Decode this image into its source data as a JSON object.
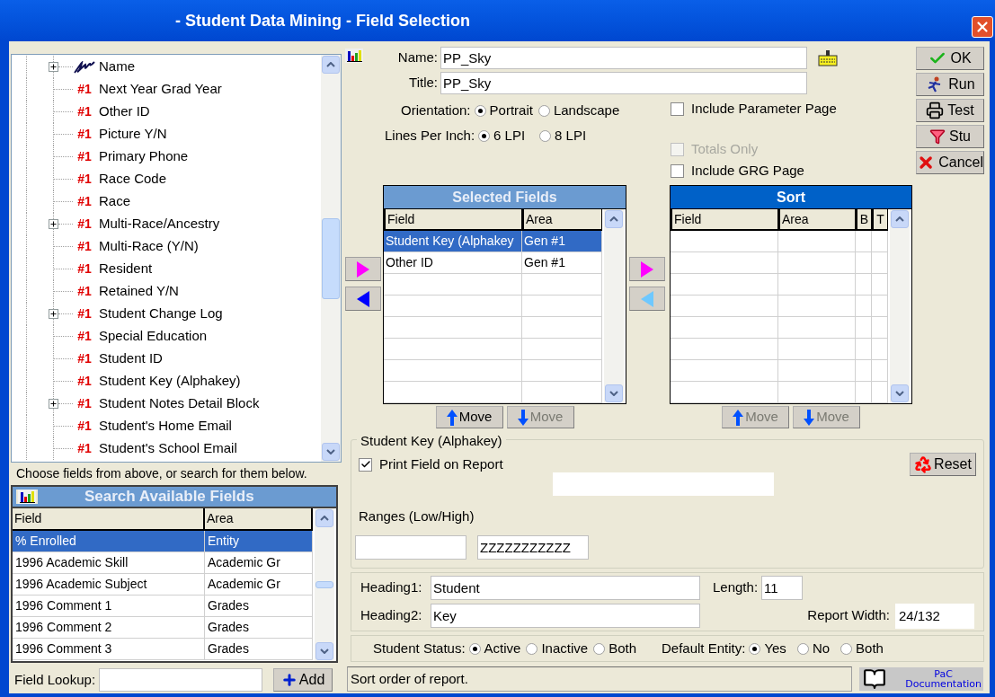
{
  "window": {
    "title": "- Student Data Mining - Field Selection"
  },
  "tree": {
    "items": [
      {
        "label": "Name",
        "kind": "group",
        "expandable": true
      },
      {
        "label": "Next Year Grad Year",
        "kind": "field",
        "tag": "#1",
        "expandable": false
      },
      {
        "label": "Other ID",
        "kind": "field",
        "tag": "#1",
        "expandable": false
      },
      {
        "label": "Picture Y/N",
        "kind": "field",
        "tag": "#1",
        "expandable": false
      },
      {
        "label": "Primary Phone",
        "kind": "field",
        "tag": "#1",
        "expandable": false
      },
      {
        "label": "Race Code",
        "kind": "field",
        "tag": "#1",
        "expandable": false
      },
      {
        "label": "Race",
        "kind": "field",
        "tag": "#1",
        "expandable": false
      },
      {
        "label": "Multi-Race/Ancestry",
        "kind": "field",
        "tag": "#1",
        "expandable": true
      },
      {
        "label": "Multi-Race (Y/N)",
        "kind": "field",
        "tag": "#1",
        "expandable": false
      },
      {
        "label": "Resident",
        "kind": "field",
        "tag": "#1",
        "expandable": false
      },
      {
        "label": "Retained Y/N",
        "kind": "field",
        "tag": "#1",
        "expandable": false
      },
      {
        "label": "Student Change Log",
        "kind": "field",
        "tag": "#1",
        "expandable": true
      },
      {
        "label": "Special Education",
        "kind": "field",
        "tag": "#1",
        "expandable": false
      },
      {
        "label": "Student ID",
        "kind": "field",
        "tag": "#1",
        "expandable": false
      },
      {
        "label": "Student Key (Alphakey)",
        "kind": "field",
        "tag": "#1",
        "expandable": false
      },
      {
        "label": "Student Notes Detail Block",
        "kind": "field",
        "tag": "#1",
        "expandable": true
      },
      {
        "label": "Student's Home Email",
        "kind": "field",
        "tag": "#1",
        "expandable": false
      },
      {
        "label": "Student's School Email",
        "kind": "field",
        "tag": "#1",
        "expandable": false
      }
    ]
  },
  "hint": "Choose fields from above, or search for them below.",
  "search": {
    "title": "Search Available Fields",
    "active": false,
    "columns": [
      "Field",
      "Area"
    ],
    "rows": [
      {
        "cells": [
          "% Enrolled",
          "Entity"
        ],
        "selected": true
      },
      {
        "cells": [
          "1996 Academic Skill",
          "Academic Gr"
        ],
        "selected": false
      },
      {
        "cells": [
          "1996 Academic Subject",
          "Academic Gr"
        ],
        "selected": false
      },
      {
        "cells": [
          "1996 Comment 1",
          "Grades"
        ],
        "selected": false
      },
      {
        "cells": [
          "1996 Comment 2",
          "Grades"
        ],
        "selected": false
      },
      {
        "cells": [
          "1996 Comment 3",
          "Grades"
        ],
        "selected": false
      }
    ]
  },
  "lookup": {
    "label": "Field Lookup:",
    "button": "Add"
  },
  "form": {
    "name_label": "Name:",
    "name": "PP_Sky",
    "title_label": "Title:",
    "title": "PP_Sky",
    "orientation": {
      "label": "Orientation:",
      "options": [
        {
          "label": "Portrait",
          "selected": true
        },
        {
          "label": "Landscape",
          "selected": false
        }
      ]
    },
    "lpi": {
      "label": "Lines Per Inch:",
      "options": [
        {
          "label": "6 LPI",
          "selected": true
        },
        {
          "label": "8 LPI",
          "selected": false
        }
      ]
    },
    "checks": [
      {
        "label": "Include Parameter Page",
        "checked": false,
        "disabled": false
      },
      {
        "label": "Totals Only",
        "checked": false,
        "disabled": true
      },
      {
        "label": "Include GRG Page",
        "checked": false,
        "disabled": false
      }
    ]
  },
  "buttons": [
    {
      "label": "OK",
      "kind": "ok"
    },
    {
      "label": "Run",
      "kind": "run"
    },
    {
      "label": "Test",
      "kind": "test"
    },
    {
      "label": "Stu",
      "kind": "stu"
    },
    {
      "label": "Cancel",
      "kind": "cancel"
    }
  ],
  "arrows_left": [
    {
      "kind": "right",
      "disabled": false
    },
    {
      "kind": "left",
      "disabled": false
    }
  ],
  "arrows_mid": [
    {
      "kind": "right",
      "disabled": false
    },
    {
      "kind": "left",
      "disabled": true
    }
  ],
  "selected_fields": {
    "title": "Selected Fields",
    "active": false,
    "columns": [
      "Field",
      "Area"
    ],
    "rows": [
      {
        "cells": [
          "Student Key (Alphakey",
          "Gen #1"
        ],
        "selected": true
      },
      {
        "cells": [
          "Other ID",
          "Gen #1"
        ],
        "selected": false
      }
    ],
    "move": [
      {
        "label": "Move",
        "kind": "up",
        "disabled": false
      },
      {
        "label": "Move",
        "kind": "down",
        "disabled": true
      }
    ]
  },
  "sort": {
    "title": "Sort",
    "active": true,
    "columns": [
      "Field",
      "Area",
      "B",
      "T"
    ],
    "move": [
      {
        "label": "Move",
        "kind": "up",
        "disabled": true
      },
      {
        "label": "Move",
        "kind": "down",
        "disabled": true
      }
    ]
  },
  "detail": {
    "legend": "Student Key (Alphakey)",
    "print": {
      "label": "Print Field on Report",
      "checked": true
    },
    "reset": "Reset",
    "ranges_label": "Ranges (Low/High)",
    "high": "ZZZZZZZZZZZ"
  },
  "headings": {
    "h1_label": "Heading1:",
    "h1": "Student",
    "h2_label": "Heading2:",
    "h2": "Key",
    "length_label": "Length:",
    "length": "11",
    "width_label": "Report Width:",
    "width": "24/132"
  },
  "student_status": {
    "label": "Student Status:",
    "options": [
      {
        "label": "Active",
        "selected": true
      },
      {
        "label": "Inactive",
        "selected": false
      },
      {
        "label": "Both",
        "selected": false
      }
    ]
  },
  "default_entity": {
    "label": "Default Entity:",
    "options": [
      {
        "label": "Yes",
        "selected": true
      },
      {
        "label": "No",
        "selected": false
      },
      {
        "label": "Both",
        "selected": false
      }
    ]
  },
  "status_bar": {
    "text": "Sort order of report.",
    "doc_line1": "PaC",
    "doc_line2": "Documentation"
  }
}
